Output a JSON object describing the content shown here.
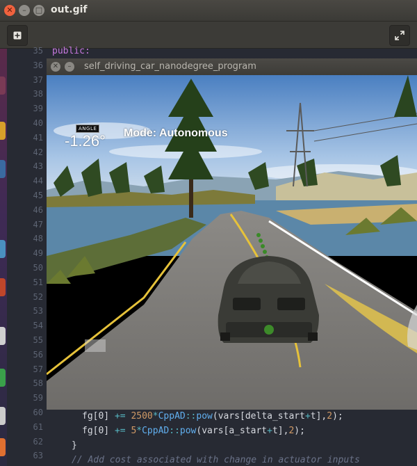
{
  "window": {
    "title": "out.gif"
  },
  "toolbar": {
    "new_icon": "plus-box-icon",
    "fullscreen_icon": "expand-icon"
  },
  "simulator": {
    "title": "self_driving_car_nanodegree_program",
    "angle_label": "ANGLE",
    "angle_value": "-1.26°",
    "mode_text": "Mode: Autonomous"
  },
  "editor": {
    "line_numbers": [
      "35",
      "36",
      "37",
      "38",
      "39",
      "40",
      "41",
      "42",
      "43",
      "44",
      "45",
      "46",
      "47",
      "48",
      "49",
      "50",
      "51",
      "52",
      "53",
      "54",
      "55",
      "56",
      "57",
      "58",
      "59",
      "60",
      "61",
      "62",
      "63"
    ],
    "line36_text": "public:",
    "line60": {
      "a": "fg[0] ",
      "b": "+=",
      "c": " 2500",
      "d": "*",
      "e": "CppAD",
      "f": "::",
      "g": "pow",
      "h": "(vars[delta_start",
      "i": "+",
      "j": "t],",
      "k": "2",
      "l": ");"
    },
    "line61": {
      "a": "fg[0] ",
      "b": "+=",
      "c": " 5",
      "d": "*",
      "e": "CppAD",
      "f": "::",
      "g": "pow",
      "h": "(vars[a_start",
      "i": "+",
      "j": "t],",
      "k": "2",
      "l": ");"
    },
    "line62": "}",
    "line63": "// Add cost associated with change in actuator inputs"
  },
  "colors": {
    "accent_close": "#f0623e",
    "editor_bg": "#272a33",
    "keyword": "#c678dd"
  }
}
